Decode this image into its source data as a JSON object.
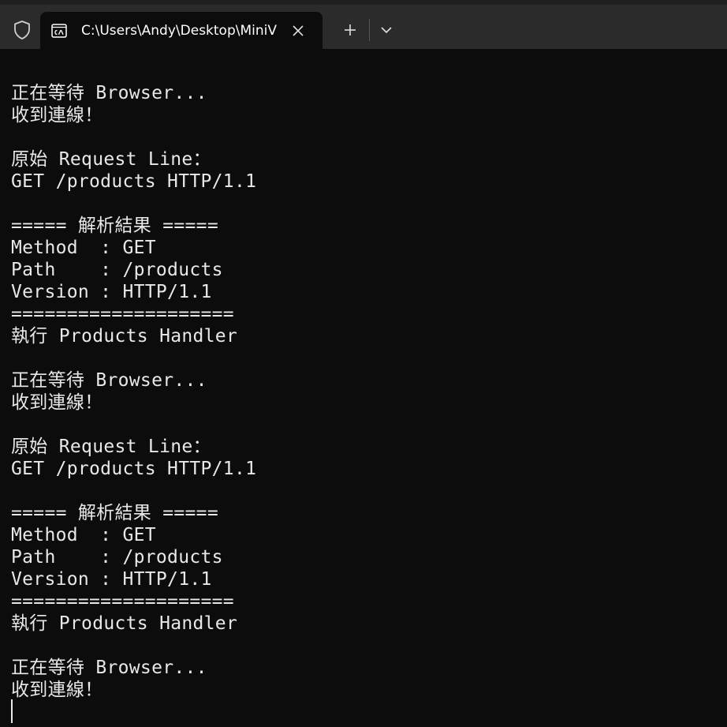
{
  "window": {
    "tab_title": "C:\\Users\\Andy\\Desktop\\MiniV",
    "colors": {
      "background": "#0c0c0c",
      "tabstrip": "#2b2b2b",
      "text": "#e8e8e8"
    },
    "icons": {
      "shield": "shield-icon",
      "tab": "cmd-icon",
      "close": "close-icon",
      "new_tab": "plus-icon",
      "dropdown": "chevron-down-icon"
    }
  },
  "terminal": {
    "lines": [
      "正在等待 Browser...",
      "收到連線！",
      "",
      "原始 Request Line：",
      "GET /products HTTP/1.1",
      "",
      "===== 解析結果 =====",
      "Method  : GET",
      "Path    : /products",
      "Version : HTTP/1.1",
      "====================",
      "執行 Products Handler",
      "",
      "正在等待 Browser...",
      "收到連線！",
      "",
      "原始 Request Line：",
      "GET /products HTTP/1.1",
      "",
      "===== 解析結果 =====",
      "Method  : GET",
      "Path    : /products",
      "Version : HTTP/1.1",
      "====================",
      "執行 Products Handler",
      "",
      "正在等待 Browser...",
      "收到連線！"
    ]
  }
}
